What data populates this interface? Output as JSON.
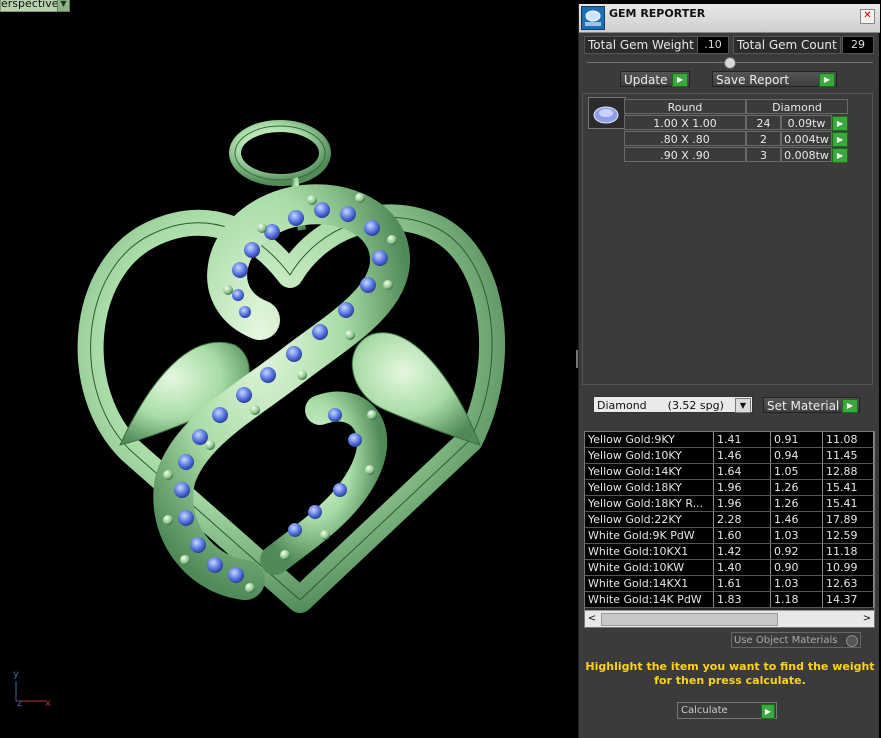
{
  "viewport": {
    "label": "erspective",
    "axes": {
      "y": "y",
      "z": "z",
      "x": "x"
    }
  },
  "panel": {
    "title": "GEM REPORTER",
    "total_gem_weight_label": "Total Gem Weight",
    "total_gem_weight_value": ".10",
    "total_gem_count_label": "Total Gem Count",
    "total_gem_count_value": "29",
    "update_label": "Update",
    "save_report_label": "Save Report",
    "gem_table": {
      "headers": [
        "Round",
        "Diamond"
      ],
      "rows": [
        {
          "size": "1.00 X 1.00",
          "count": "24",
          "weight": "0.09tw"
        },
        {
          "size": ".80 X .80",
          "count": "2",
          "weight": "0.004tw"
        },
        {
          "size": ".90 X .90",
          "count": "3",
          "weight": "0.008tw"
        }
      ]
    },
    "material_select": {
      "value": "Diamond      (3.52 spg)"
    },
    "set_material_label": "Set Material",
    "materials": [
      {
        "name": "Yellow Gold:9KY",
        "v1": "1.41",
        "v2": "0.91",
        "v3": "11.08"
      },
      {
        "name": "Yellow Gold:10KY",
        "v1": "1.46",
        "v2": "0.94",
        "v3": "11.45"
      },
      {
        "name": "Yellow Gold:14KY",
        "v1": "1.64",
        "v2": "1.05",
        "v3": "12.88"
      },
      {
        "name": "Yellow Gold:18KY",
        "v1": "1.96",
        "v2": "1.26",
        "v3": "15.41"
      },
      {
        "name": "Yellow Gold:18KY R...",
        "v1": "1.96",
        "v2": "1.26",
        "v3": "15.41"
      },
      {
        "name": "Yellow Gold:22KY",
        "v1": "2.28",
        "v2": "1.46",
        "v3": "17.89"
      },
      {
        "name": "White Gold:9K PdW",
        "v1": "1.60",
        "v2": "1.03",
        "v3": "12.59"
      },
      {
        "name": "White Gold:10KX1",
        "v1": "1.42",
        "v2": "0.92",
        "v3": "11.18"
      },
      {
        "name": "White Gold:10KW",
        "v1": "1.40",
        "v2": "0.90",
        "v3": "10.99"
      },
      {
        "name": "White Gold:14KX1",
        "v1": "1.61",
        "v2": "1.03",
        "v3": "12.63"
      },
      {
        "name": "White Gold:14K PdW",
        "v1": "1.83",
        "v2": "1.18",
        "v3": "14.37"
      }
    ],
    "use_object_materials_label": "Use Object Materials",
    "hint_text": "Highlight the item you want to find the weight for then press calculate.",
    "calculate_label": "Calculate",
    "colors": {
      "accent_green": "#3aa83a",
      "hint_yellow": "#ffd21a",
      "metal_green": "#b5e0b5",
      "gem_blue": "#5a7fe0"
    }
  }
}
